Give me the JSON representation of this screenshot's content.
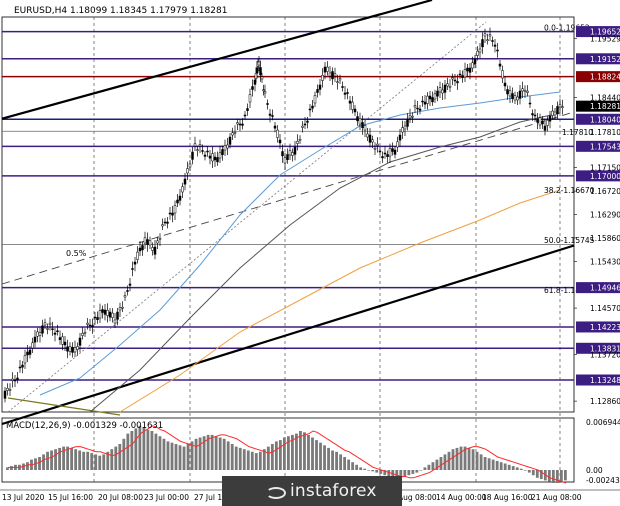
{
  "header": {
    "symbol_info": "EURUSD,H4  1.18099 1.18345 1.17979 1.18281"
  },
  "colors": {
    "background": "#ffffff",
    "candle": "#000000",
    "sma_blue": "#5b9bd5",
    "sma_orange": "#f0a040",
    "sma_gray": "#555555",
    "level_purple": "#3c1e82",
    "level_red": "#8b0000",
    "price_tag": "#000000",
    "macd_hist": "#7a7a7a",
    "macd_signal": "#ff2a2a",
    "trendline": "#000000",
    "fib_dotted": "#777777"
  },
  "chart_data": [
    {
      "type": "candlestick",
      "title": "EURUSD,H4",
      "ohlc_latest": {
        "open": 1.18099,
        "high": 1.18345,
        "low": 1.17979,
        "close": 1.18281
      },
      "ylim": [
        1.1266,
        1.1992
      ],
      "y_ticks": [
        "1.19652",
        "1.19529",
        "1.19152",
        "1.18824",
        "1.18440",
        "1.18281",
        "1.18040",
        "1.17810",
        "1.17543",
        "1.17150",
        "1.17000",
        "1.16720",
        "1.16290",
        "1.15860",
        "1.15430",
        "1.14946",
        "1.14570",
        "1.14223",
        "1.13831",
        "1.13720",
        "1.13248",
        "1.12860"
      ],
      "x_tick_labels": [
        "13 Jul 2020",
        "15 Jul 16:00",
        "20 Jul 08:00",
        "23 Jul 00:00",
        "27 Jul 16:00",
        "Aug 08:00",
        "14 Aug 00:00",
        "18 Aug 16:00",
        "21 Aug 08:00"
      ],
      "horizontal_levels": [
        {
          "price": 1.19652,
          "label": "1.19652",
          "style": "purple"
        },
        {
          "price": 1.19152,
          "label": "1.19152",
          "style": "purple"
        },
        {
          "price": 1.18824,
          "label": "1.18824",
          "style": "red"
        },
        {
          "price": 1.1804,
          "label": "1.18040",
          "style": "navy"
        },
        {
          "price": 1.17543,
          "label": "1.17543",
          "style": "purple"
        },
        {
          "price": 1.17,
          "label": "1.17000",
          "style": "purple"
        },
        {
          "price": 1.14946,
          "label": "1.14946",
          "style": "purple"
        },
        {
          "price": 1.14223,
          "label": "1.14223",
          "style": "purple"
        },
        {
          "price": 1.13831,
          "label": "1.13831",
          "style": "purple"
        },
        {
          "price": 1.13248,
          "label": "1.13248",
          "style": "purple"
        }
      ],
      "fibonacci_levels": [
        {
          "label": "0.0-1.19652",
          "price": 1.19652
        },
        {
          "label": "38.2-1.16670",
          "price": 1.1667
        },
        {
          "label": "50.0-1.15745",
          "price": 1.15745
        },
        {
          "label": "61.8-1.14829",
          "price": 1.14829
        }
      ],
      "annotations": [
        {
          "text": "0.5%"
        }
      ],
      "current_price": 1.18281,
      "grid": true
    },
    {
      "type": "histogram",
      "title": "MACD(12,26,9) -0.001329 -0.001631",
      "series": [
        {
          "name": "MACD",
          "kind": "bars",
          "latest": -0.001329
        },
        {
          "name": "Signal",
          "kind": "line",
          "latest": -0.001631
        }
      ],
      "y_ticks": [
        "0.006944",
        "0.00",
        "-0.002434"
      ]
    }
  ],
  "watermark": {
    "brand_text": "instaforex"
  }
}
